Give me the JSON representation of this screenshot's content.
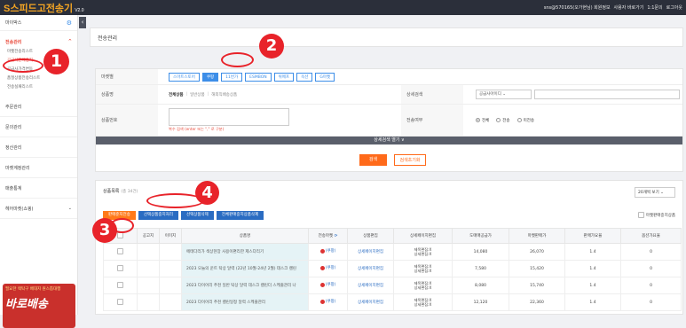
{
  "header": {
    "logo_text": "S스피드고전송기",
    "version": "V2.0",
    "user": "sns@570165(오가현님) 회원정보",
    "links": [
      "사용자 바로가기",
      "1:1문의",
      "로그아웃"
    ]
  },
  "sidebar": {
    "mypage": "마이박스",
    "transfer_head": "전송관리",
    "subs": [
      "마켓전송리스트",
      "공급사판매중지",
      "공급사가격변동",
      "품절상품전송리스트",
      "전송실패리스트"
    ],
    "sections": [
      "주문관리",
      "문의관리",
      "정산관리",
      "마켓계정관리",
      "매출통계",
      "헤어마켓(쇼핑)"
    ],
    "banner_top": "필요한 렉탁구 배대지 원스톱대행",
    "banner_brand": "바로배송"
  },
  "page": {
    "title": "전송관리"
  },
  "search": {
    "market_label": "마켓별",
    "markets": [
      "스마트스토어",
      "쿠팡",
      "11번가",
      "ESMBON",
      "위메프",
      "옥션",
      "G마켓"
    ],
    "market_selected": 1,
    "product_label": "상품명",
    "product_opts": [
      "전체상품",
      "일반상품",
      "해외직배송상품"
    ],
    "detail_label": "상세검색",
    "detail_select": "공급사아이디",
    "code_label": "상품번호",
    "code_hint": "복수 검색 (enter 또는 \",\" 로 구분)",
    "send_label": "전송여부",
    "send_opts": [
      "전체",
      "전송",
      "미전송"
    ],
    "expand": "상세검색 열기 ∨",
    "btn_search": "검색",
    "btn_reset": "검색초기화"
  },
  "list": {
    "title": "상품목록",
    "count": "(총 34건)",
    "perpage": "20개씩 보기",
    "actions": [
      "판매준지전송",
      "선택상품중지처리",
      "선택상품삭제",
      "전체판매중지상품삭제"
    ],
    "sold_filter": "마켓판매중지상품",
    "columns": [
      "",
      "공고지",
      "이미지",
      "상품명",
      "전송마켓",
      "상품편집",
      "상세페이지편집",
      "도매매공급가",
      "마켓판매가",
      "판매가요율",
      "옵션가요율"
    ],
    "rows": [
      {
        "name": "에테다리가 색상현장 사용이편리한 제스다리기",
        "mkt": "(쿠팡)",
        "edit": "상세페이지편집",
        "d1": "제목편집:X",
        "d2": "상세편집:X",
        "supply": "14,080",
        "price": "26,070",
        "rate": "1.4",
        "opt": "0"
      },
      {
        "name": "2023 오늘의 운트 탁상 달력 (22년 10월-24년 2월) 데스크 캘린",
        "mkt": "(쿠팡)",
        "edit": "상세페이지편집",
        "d1": "제목편집:X",
        "d2": "상세편집:X",
        "supply": "7,580",
        "price": "15,420",
        "rate": "1.4",
        "opt": "0"
      },
      {
        "name": "2023 다이어리 추천 일반 탁상 달력 데스크 캘린더 스케줄관리 나",
        "mkt": "(쿠팡)",
        "edit": "상세페이지편집",
        "d1": "제목편집:X",
        "d2": "상세편집:X",
        "supply": "8,080",
        "price": "15,740",
        "rate": "1.4",
        "opt": "0"
      },
      {
        "name": "2023 다이어리 추천 캘린일정 달력 스케줄관리",
        "mkt": "(쿠팡)",
        "edit": "상세페이지편집",
        "d1": "제목편집:X",
        "d2": "상세편집:X",
        "supply": "12,120",
        "price": "22,360",
        "rate": "1.4",
        "opt": "0"
      }
    ]
  },
  "markers": [
    "1",
    "2",
    "3",
    "4"
  ]
}
